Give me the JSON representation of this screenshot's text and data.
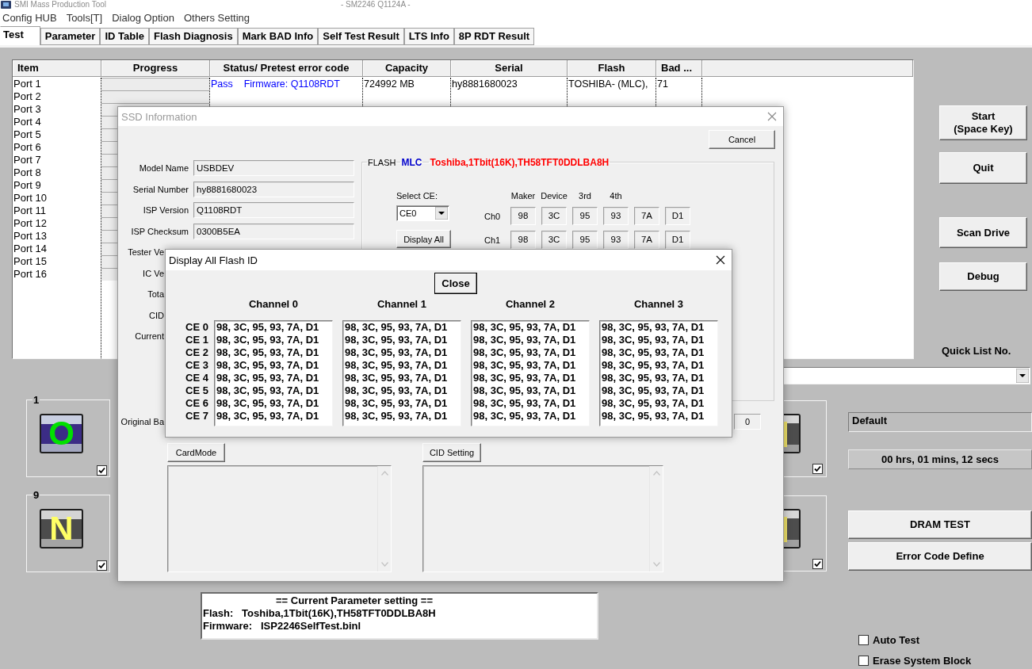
{
  "window": {
    "title": "SMI Mass Production Tool",
    "subtitle": "- SM2246 Q1124A -",
    "active": false
  },
  "menu": [
    "Config HUB",
    "Tools[T]",
    "Dialog Option",
    "Others Setting"
  ],
  "tabs": [
    {
      "label": "Test",
      "selected": true
    },
    {
      "label": "Parameter",
      "selected": false
    },
    {
      "label": "ID Table",
      "selected": false
    },
    {
      "label": "Flash Diagnosis",
      "selected": false
    },
    {
      "label": "Mark BAD Info",
      "selected": false
    },
    {
      "label": "Self Test Result",
      "selected": false
    },
    {
      "label": "LTS Info",
      "selected": false
    },
    {
      "label": "8P RDT Result",
      "selected": false
    }
  ],
  "table": {
    "columns": [
      "Item",
      "Progress",
      "Status/ Pretest error code",
      "Capacity",
      "Serial",
      "Flash",
      "Bad ..."
    ],
    "rows": [
      {
        "item": "Port 1",
        "level": 0,
        "status": "Pass    Firmware: Q1108RDT",
        "capacity": "724992 MB",
        "serial": "hy8881680023",
        "flash": "TOSHIBA- (MLC),",
        "bad": "71"
      },
      {
        "item": "Port 2",
        "level": 0
      },
      {
        "item": "Port 3",
        "level": 0
      },
      {
        "item": "Port 4",
        "level": 0
      },
      {
        "item": "Port 5",
        "level": 0
      },
      {
        "item": "Port 6",
        "level": 0
      },
      {
        "item": "Port 7",
        "level": 0
      },
      {
        "item": "Port 8",
        "level": 0
      },
      {
        "item": "Port 9",
        "level": 0
      },
      {
        "item": "Port 10",
        "level": 0
      },
      {
        "item": "Port 11",
        "level": 0
      },
      {
        "item": "Port 12",
        "level": 0
      },
      {
        "item": "Port 13",
        "level": 0
      },
      {
        "item": "Port 14",
        "level": 0
      },
      {
        "item": "Port 15",
        "level": 0
      },
      {
        "item": "Port 16",
        "level": 0
      }
    ]
  },
  "side_buttons": [
    "Start\n(Space Key)",
    "Quit",
    "Scan Drive",
    "Debug"
  ],
  "quick_list": {
    "label": "Quick List No."
  },
  "port_panels": [
    {
      "number": "1",
      "letter": "O",
      "kind": "active",
      "checked": true
    },
    {
      "number": "9",
      "letter": "N",
      "kind": "idle",
      "checked": true
    }
  ],
  "right_panels": [
    {
      "checked": true
    },
    {
      "checked": true
    }
  ],
  "profile": "Default",
  "elapsed": "00 hrs, 01 mins, 12 secs",
  "tool_buttons": [
    "DRAM TEST",
    "Error Code Define"
  ],
  "parameter_box": {
    "heading": "== Current Parameter setting ==",
    "lines": [
      "Flash:   Toshiba,1Tbit(16K),TH58TFT0DDLBA8H",
      "Firmware:   ISP2246SelfTest.binl"
    ]
  },
  "options": [
    {
      "label": "Auto Test",
      "checked": false
    },
    {
      "label": "Erase System Block",
      "checked": false
    }
  ],
  "ssd_dialog": {
    "title": "SSD Information",
    "active": false,
    "cancel": "Cancel",
    "fields": [
      {
        "label": "Model Name",
        "value": "USBDEV"
      },
      {
        "label": "Serial Number",
        "value": "hy8881680023"
      },
      {
        "label": "ISP Version",
        "value": "Q1108RDT"
      },
      {
        "label": "ISP Checksum",
        "value": "0300B5EA"
      }
    ],
    "covered_labels": [
      "Tester Ve",
      "IC Ve",
      "Tota",
      "CID",
      "Current"
    ],
    "original_bad": {
      "label": "Original Ba",
      "value": "0"
    },
    "flash_group": {
      "label": "FLASH",
      "type": "MLC",
      "part": "Toshiba,1Tbit(16K),TH58TFT0DDLBA8H",
      "select_label": "Select CE:",
      "select_value": "CE0",
      "display_all": "Display All",
      "id_headers": [
        "Maker",
        "Device",
        "3rd",
        "4th"
      ],
      "channels": [
        {
          "name": "Ch0",
          "bytes": [
            "98",
            "3C",
            "95",
            "93",
            "7A",
            "D1"
          ]
        },
        {
          "name": "Ch1",
          "bytes": [
            "98",
            "3C",
            "95",
            "93",
            "7A",
            "D1"
          ]
        }
      ]
    },
    "card_mode": "CardMode",
    "cid_setting": "CID Setting"
  },
  "flash_id_dialog": {
    "title": "Display All Flash ID",
    "active": true,
    "close": "Close",
    "ce_labels": [
      "CE 0",
      "CE 1",
      "CE 2",
      "CE 3",
      "CE 4",
      "CE 5",
      "CE 6",
      "CE 7"
    ],
    "channels": [
      {
        "name": "Channel 0",
        "ids": [
          "98, 3C, 95, 93, 7A, D1",
          "98, 3C, 95, 93, 7A, D1",
          "98, 3C, 95, 93, 7A, D1",
          "98, 3C, 95, 93, 7A, D1",
          "98, 3C, 95, 93, 7A, D1",
          "98, 3C, 95, 93, 7A, D1",
          "98, 3C, 95, 93, 7A, D1",
          "98, 3C, 95, 93, 7A, D1"
        ]
      },
      {
        "name": "Channel 1",
        "ids": [
          "98, 3C, 95, 93, 7A, D1",
          "98, 3C, 95, 93, 7A, D1",
          "98, 3C, 95, 93, 7A, D1",
          "98, 3C, 95, 93, 7A, D1",
          "98, 3C, 95, 93, 7A, D1",
          "98, 3C, 95, 93, 7A, D1",
          "98, 3C, 95, 93, 7A, D1",
          "98, 3C, 95, 93, 7A, D1"
        ]
      },
      {
        "name": "Channel 2",
        "ids": [
          "98, 3C, 95, 93, 7A, D1",
          "98, 3C, 95, 93, 7A, D1",
          "98, 3C, 95, 93, 7A, D1",
          "98, 3C, 95, 93, 7A, D1",
          "98, 3C, 95, 93, 7A, D1",
          "98, 3C, 95, 93, 7A, D1",
          "98, 3C, 95, 93, 7A, D1",
          "98, 3C, 95, 93, 7A, D1"
        ]
      },
      {
        "name": "Channel 3",
        "ids": [
          "98, 3C, 95, 93, 7A, D1",
          "98, 3C, 95, 93, 7A, D1",
          "98, 3C, 95, 93, 7A, D1",
          "98, 3C, 95, 93, 7A, D1",
          "98, 3C, 95, 93, 7A, D1",
          "98, 3C, 95, 93, 7A, D1",
          "98, 3C, 95, 93, 7A, D1",
          "98, 3C, 95, 93, 7A, D1"
        ]
      }
    ]
  }
}
